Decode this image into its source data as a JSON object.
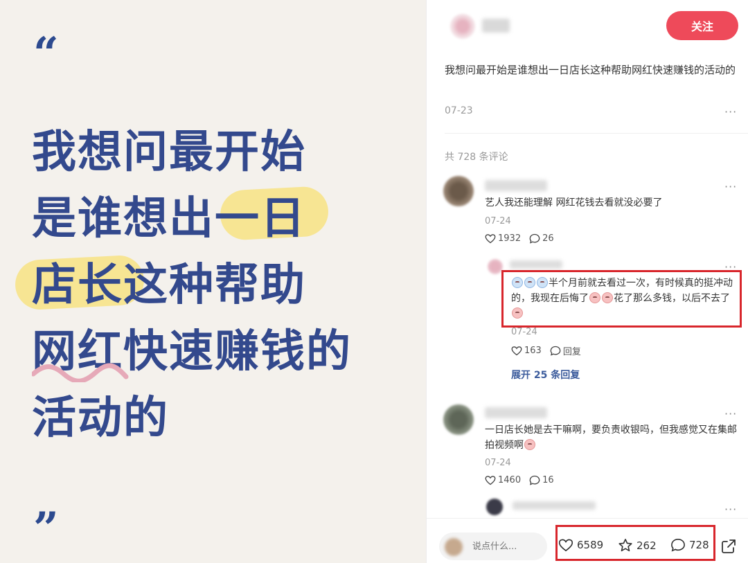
{
  "card": {
    "quote_open": "“",
    "quote_close": "”",
    "lines": [
      "我想问最开始",
      "是谁想出一日",
      "店长这种帮助",
      "网红快速赚钱的",
      "活动的"
    ]
  },
  "header": {
    "author_name": "用户",
    "follow_label": "关注"
  },
  "post": {
    "title": "我想问最开始是谁想出一日店长这种帮助网红快速赚钱的活动的",
    "date": "07-23",
    "more": "···"
  },
  "comments_summary": "共 728 条评论",
  "comments": [
    {
      "text": "艺人我还能理解 网红花钱去看就没必要了",
      "date": "07-24",
      "likes": "1932",
      "replies": "26",
      "more": "···"
    },
    {
      "reply": {
        "text_a": "半个月前就去看过一次，有时候真的挺冲动的，我现在后悔了",
        "text_b": "花了那么多钱，以后不去了",
        "date": "07-24",
        "likes": "163",
        "reply_label": "回复",
        "more": "···"
      },
      "expand_label": "展开 25 条回复"
    },
    {
      "text": "一日店长她是去干嘛啊，要负责收银吗，但我感觉又在集邮拍视频啊",
      "date": "07-24",
      "likes": "1460",
      "replies": "16",
      "more": "···"
    }
  ],
  "bottom_bar": {
    "input_placeholder": "说点什么...",
    "likes": "6589",
    "favorites": "262",
    "comments": "728"
  },
  "colors": {
    "card_bg": "#f4f1ec",
    "card_text": "#33498d",
    "highlight": "#f7e38a",
    "follow": "#ee4a5a",
    "annotation": "#d8262c",
    "link": "#3b5b9c"
  }
}
